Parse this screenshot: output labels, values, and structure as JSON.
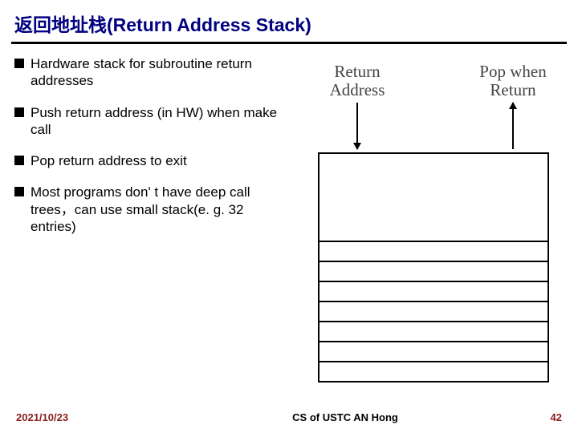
{
  "title": "返回地址栈(Return Address Stack)",
  "bullets": [
    "Hardware stack for subroutine return addresses",
    "Push return address (in HW) when make call",
    "Pop return address to exit",
    "Most programs don' t have deep call trees，can use small stack(e. g. 32 entries)"
  ],
  "diagram": {
    "label_left": "Return Address",
    "label_right": "Pop when Return"
  },
  "footer": {
    "date": "2021/10/23",
    "center": "CS of USTC AN Hong",
    "page": "42"
  }
}
